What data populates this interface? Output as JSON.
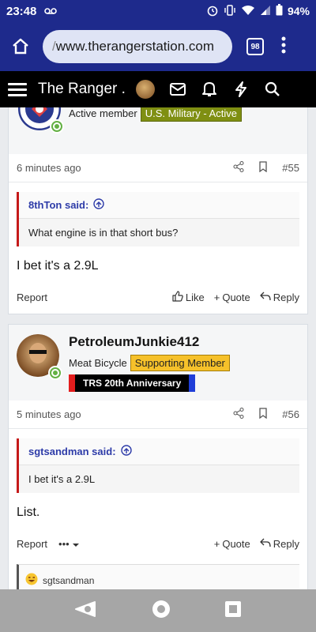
{
  "status": {
    "time": "23:48",
    "battery": "94%"
  },
  "browser": {
    "url_prefix": "/",
    "url": "www.therangerstation.com",
    "tab_count": "98"
  },
  "site": {
    "title": "The Ranger ..."
  },
  "posts": [
    {
      "user_title": "Active member",
      "user_badge": "U.S. Military - Active",
      "time": "6 minutes ago",
      "number": "#55",
      "quote_author": "8thTon said:",
      "quote_text": "What engine is in that short bus?",
      "body": "I bet it's a 2.9L",
      "report": "Report",
      "like": "Like",
      "quote": "Quote",
      "reply": "Reply"
    },
    {
      "username": "PetroleumJunkie412",
      "user_title": "Meat Bicycle",
      "user_badge": "Supporting Member",
      "anniv_badge": "TRS 20th Anniversary",
      "time": "5 minutes ago",
      "number": "#56",
      "quote_author": "sgtsandman said:",
      "quote_text": "I bet it's a 2.9L",
      "body": "List.",
      "report": "Report",
      "more": "•••",
      "quote": "Quote",
      "reply": "Reply",
      "reaction_user": "sgtsandman"
    }
  ],
  "colors": {
    "status_bar": "#1e2a8c",
    "header": "#000000",
    "quote_bar": "#c51a1a",
    "link": "#2d3ba8"
  }
}
